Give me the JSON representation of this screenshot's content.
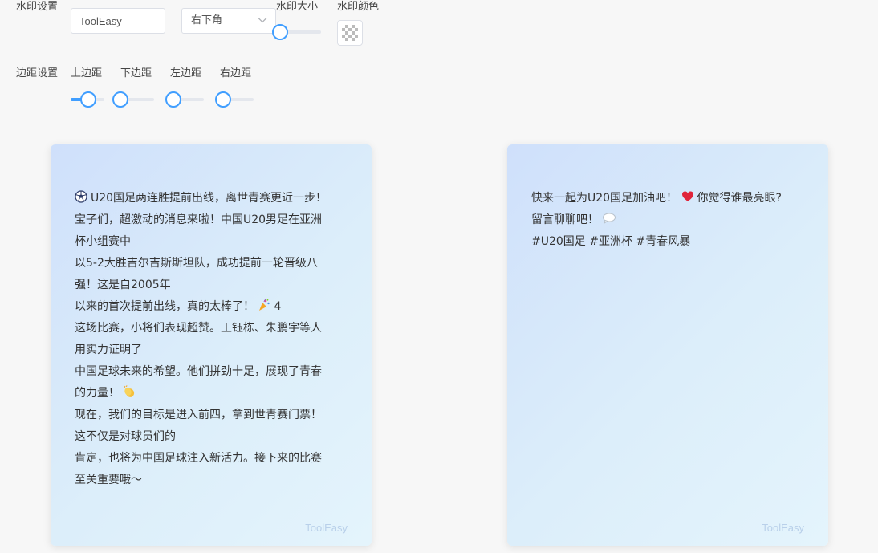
{
  "watermark_settings": {
    "label": "水印设置",
    "text_input": {
      "value": "ToolEasy"
    },
    "position_select": {
      "value": "右下角"
    },
    "size": {
      "label": "水印大小",
      "value_pct": 0
    },
    "color": {
      "label": "水印颜色"
    }
  },
  "margin_settings": {
    "label": "边距设置",
    "sliders": [
      {
        "label": "上边距",
        "value_pct": 52
      },
      {
        "label": "下边距",
        "value_pct": 0
      },
      {
        "label": "左边距",
        "value_pct": 0
      },
      {
        "label": "右边距",
        "value_pct": 0
      }
    ]
  },
  "cards": [
    {
      "lines": [
        "U20国足两连胜提前出线，离世青赛更近一步！",
        "宝子们，超激动的消息来啦！中国U20男足在亚洲",
        "杯小组赛中",
        "以5-2大胜吉尔吉斯斯坦队，成功提前一轮晋级八",
        "强！这是自2005年",
        "以来的首次提前出线，真的太棒了！",
        "这场比赛，小将们表现超赞。王钰栋、朱鹏宇等人",
        "用实力证明了",
        "中国足球未来的希望。他们拼劲十足，展现了青春",
        "的力量！",
        "现在，我们的目标是进入前四，拿到世青赛门票！",
        "这不仅是对球员们的",
        "肯定，也将为中国足球注入新活力。接下来的比赛",
        "至关重要哦～"
      ],
      "line6_suffix": "4",
      "watermark": "ToolEasy"
    },
    {
      "lines": [
        "快来一起为U20国足加油吧！",
        "你觉得谁最亮眼?",
        "留言聊聊吧！",
        "#U20国足 #亚洲杯 #青春风暴"
      ],
      "watermark": "ToolEasy"
    }
  ],
  "colors": {
    "accent": "#409eff",
    "card_start": "#cfe0fb",
    "card_end": "#e4f4fc",
    "watermark": "#b9d0ea"
  },
  "icons": [
    "soccer-ball-icon",
    "party-popper-icon",
    "clapping-hands-icon",
    "heart-icon",
    "speech-bubble-icon",
    "chevron-down-icon",
    "color-swatch-icon"
  ]
}
